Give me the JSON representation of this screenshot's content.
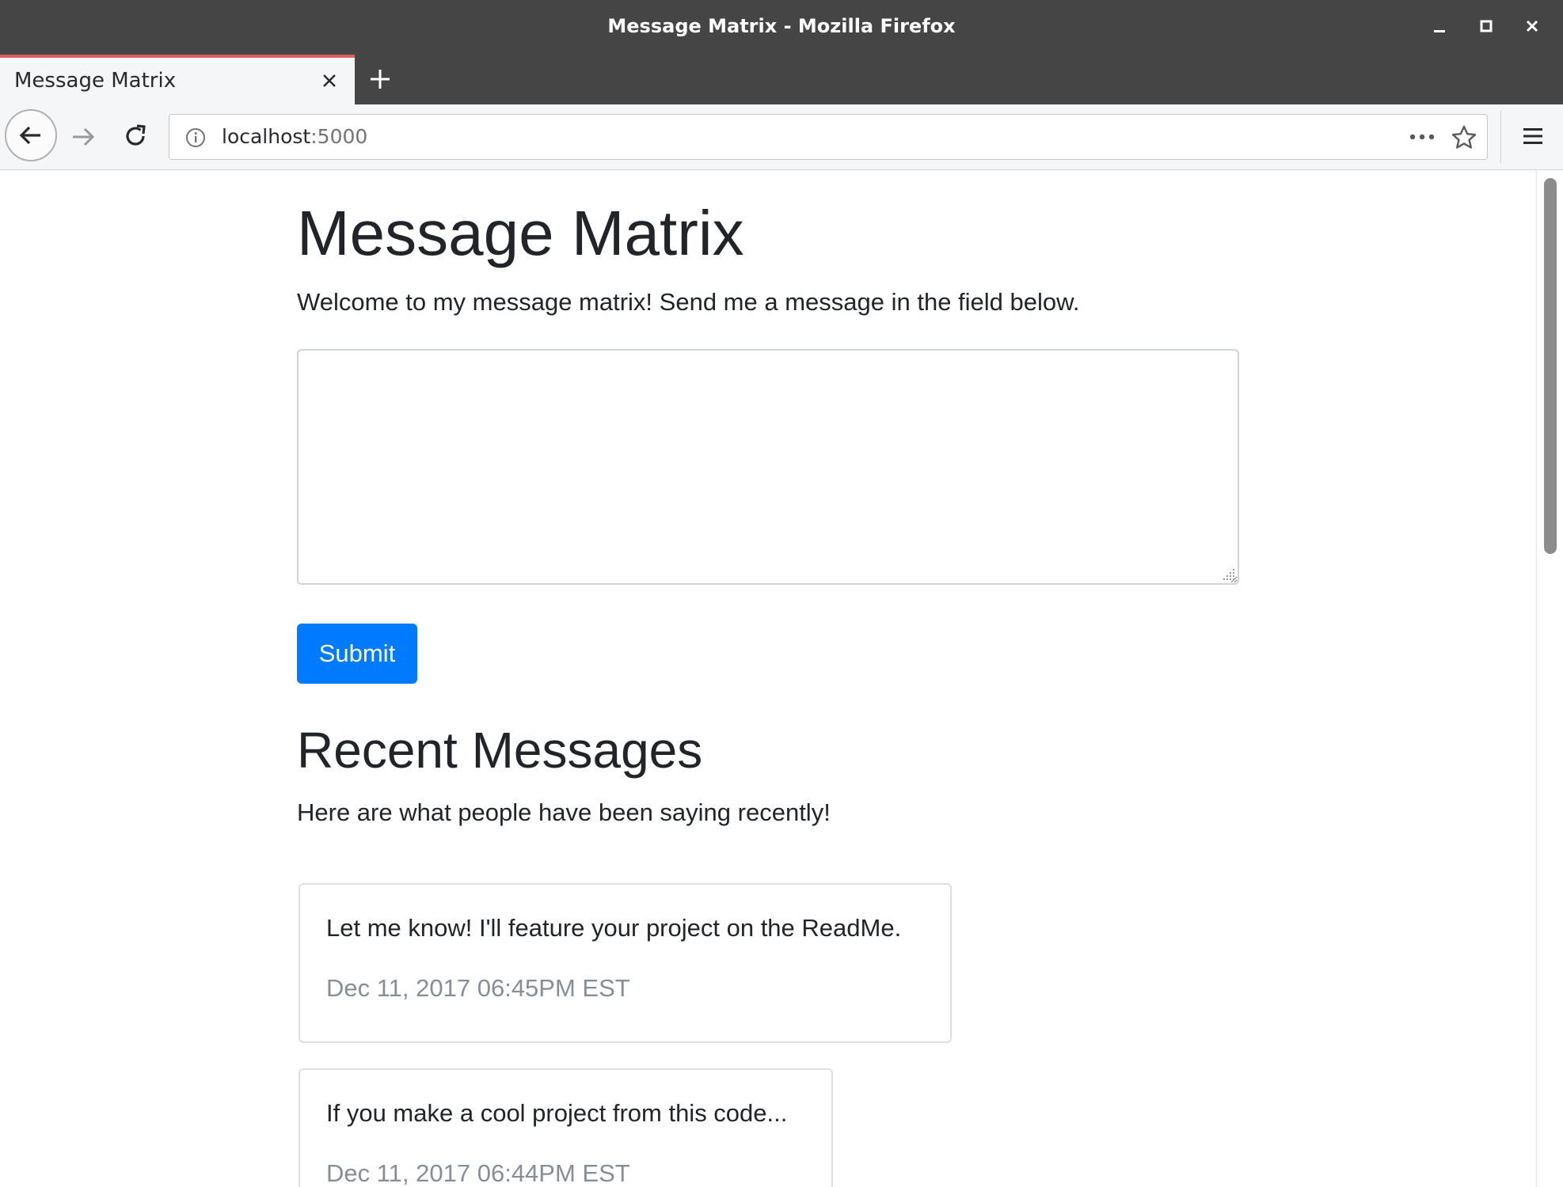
{
  "window": {
    "title": "Message Matrix - Mozilla Firefox",
    "controls": [
      "minimize-icon",
      "maximize-icon",
      "close-icon"
    ]
  },
  "tabs": [
    {
      "label": "Message Matrix",
      "active": true
    }
  ],
  "navbar": {
    "url_host": "localhost",
    "url_port": ":5000",
    "icons": [
      "back-arrow-icon",
      "forward-arrow-icon",
      "reload-icon",
      "info-icon",
      "more-dots-icon",
      "star-icon",
      "hamburger-menu-icon"
    ]
  },
  "page": {
    "title": "Message Matrix",
    "intro": "Welcome to my message matrix! Send me a message in the field below.",
    "message_input": {
      "value": "",
      "placeholder": ""
    },
    "submit_label": "Submit",
    "recent_heading": "Recent Messages",
    "recent_intro": "Here are what people have been saying recently!",
    "messages": [
      {
        "text": "Let me know! I'll feature your project on the ReadMe.",
        "timestamp": "Dec 11, 2017 06:45PM EST"
      },
      {
        "text": "If you make a cool project from this code...",
        "timestamp": "Dec 11, 2017 06:44PM EST"
      }
    ]
  },
  "colors": {
    "chrome_dark": "#454545",
    "tab_accent": "#e05d5d",
    "primary_button": "#007bff",
    "body_text": "#212529",
    "muted_text": "#868e96"
  }
}
